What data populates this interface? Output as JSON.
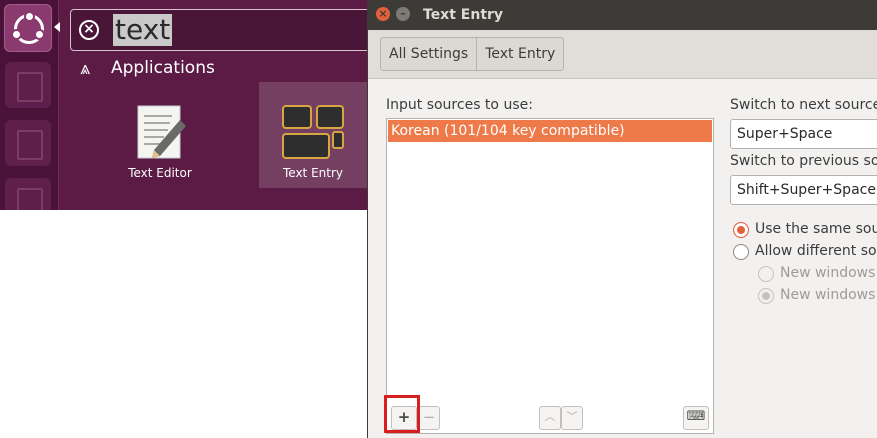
{
  "dash": {
    "search_query": "text",
    "category_label": "Applications",
    "apps": [
      {
        "label": "Text Editor"
      },
      {
        "label": "Text Entry"
      }
    ]
  },
  "window": {
    "title": "Text Entry",
    "breadcrumbs": [
      "All Settings",
      "Text Entry"
    ],
    "input_sources_label": "Input sources to use:",
    "input_sources": [
      "Korean (101/104 key compatible)"
    ],
    "list_toolbar": {
      "add": "+",
      "remove": "−",
      "move_up": "︿",
      "move_down": "﹀",
      "keyboard": "⌨"
    },
    "switch_next_label": "Switch to next source",
    "switch_next_value": "Super+Space",
    "switch_prev_label": "Switch to previous so",
    "switch_prev_value": "Shift+Super+Space",
    "radio_same": "Use the same sour",
    "radio_allow": "Allow different so",
    "radio_new1": "New windows",
    "radio_new2": "New windows"
  },
  "colors": {
    "accent": "#ef7a49",
    "dash_bg": "#5b1b45",
    "titlebar": "#3c3b37",
    "highlight": "#d81e1e"
  }
}
